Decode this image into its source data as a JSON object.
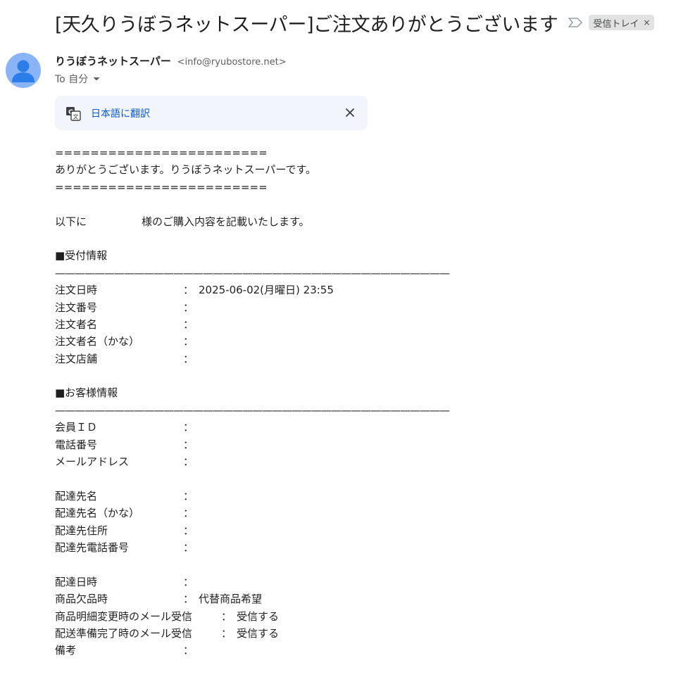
{
  "subject": "[天久りうぼうネットスーパー]ご注文ありがとうございます",
  "label_chip": {
    "text": "受信トレイ",
    "remove": "×"
  },
  "sender": {
    "name": "りうぼうネットスーパー",
    "email": "<info@ryubostore.net>"
  },
  "to_line": "To 自分",
  "translate": {
    "link": "日本語に翻訳"
  },
  "body": {
    "equals_line": "========================",
    "greeting": "ありがとうございます。りうぼうネットスーパーです。",
    "intro_prefix": "以下に",
    "intro_suffix": "様のご購入内容を記載いたします。",
    "rule": "————————————————————————————————————————",
    "section_reception": "■受付情報",
    "reception": [
      {
        "key": "注文日時",
        "colon": "：",
        "value": "2025-06-02(月曜日) 23:55"
      },
      {
        "key": "注文番号",
        "colon": "：",
        "value": ""
      },
      {
        "key": "注文者名",
        "colon": "：",
        "value": ""
      },
      {
        "key": "注文者名（かな）",
        "colon": "：",
        "value": ""
      },
      {
        "key": "注文店舗",
        "colon": "：",
        "value": ""
      }
    ],
    "section_customer": "■お客様情報",
    "customer": [
      {
        "key": "会員ＩＤ",
        "colon": "：",
        "value": ""
      },
      {
        "key": "電話番号",
        "colon": "：",
        "value": ""
      },
      {
        "key": "メールアドレス",
        "colon": "：",
        "value": ""
      }
    ],
    "delivery": [
      {
        "key": "配達先名",
        "colon": "：",
        "value": ""
      },
      {
        "key": "配達先名（かな）",
        "colon": "：",
        "value": ""
      },
      {
        "key": "配達先住所",
        "colon": "：",
        "value": ""
      },
      {
        "key": "配達先電話番号",
        "colon": "：",
        "value": ""
      }
    ],
    "options": [
      {
        "key": "配達日時",
        "colon": "：",
        "value": ""
      },
      {
        "key": "商品欠品時",
        "colon": "：",
        "value": "代替商品希望"
      }
    ],
    "options_wide": [
      {
        "key": "商品明細変更時のメール受信",
        "colon": "：",
        "value": "受信する"
      },
      {
        "key": "配送準備完了時のメール受信",
        "colon": "：",
        "value": "受信する"
      }
    ],
    "options_last": [
      {
        "key": "備考",
        "colon": "：",
        "value": ""
      }
    ]
  },
  "colors": {
    "avatar": "#8ab4f8",
    "translate_bg": "#f2f6fc",
    "link": "#0b57d0",
    "chip_bg": "#e2e2e2"
  },
  "icons": [
    "importance-marker-icon",
    "chevron-down-icon",
    "translate-icon",
    "close-icon",
    "avatar-person-icon"
  ]
}
